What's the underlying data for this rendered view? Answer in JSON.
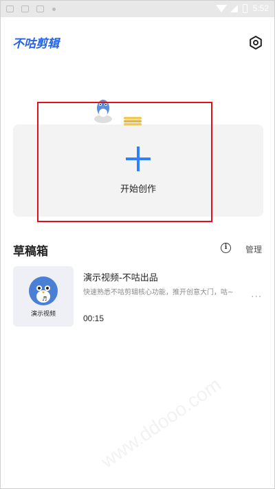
{
  "status_bar": {
    "time": "5:52"
  },
  "header": {
    "app_logo": "不咕剪辑",
    "settings_icon": "gear-icon"
  },
  "create": {
    "label": "开始创作",
    "icon": "plus-icon"
  },
  "drafts": {
    "title": "草稿箱",
    "info_icon": "info-icon",
    "manage_label": "管理",
    "items": [
      {
        "title": "演示视频-不咕出品",
        "description": "快速熟悉不咕剪辑核心功能，推开创意大门，咕~",
        "duration": "00:15",
        "thumbnail_label": "演示视频",
        "more_label": "···"
      }
    ]
  },
  "watermark": {
    "text": "www.ddooo.com"
  },
  "colors": {
    "accent": "#2f80ff",
    "logo": "#2462e6",
    "highlight_frame": "#e0101a"
  }
}
